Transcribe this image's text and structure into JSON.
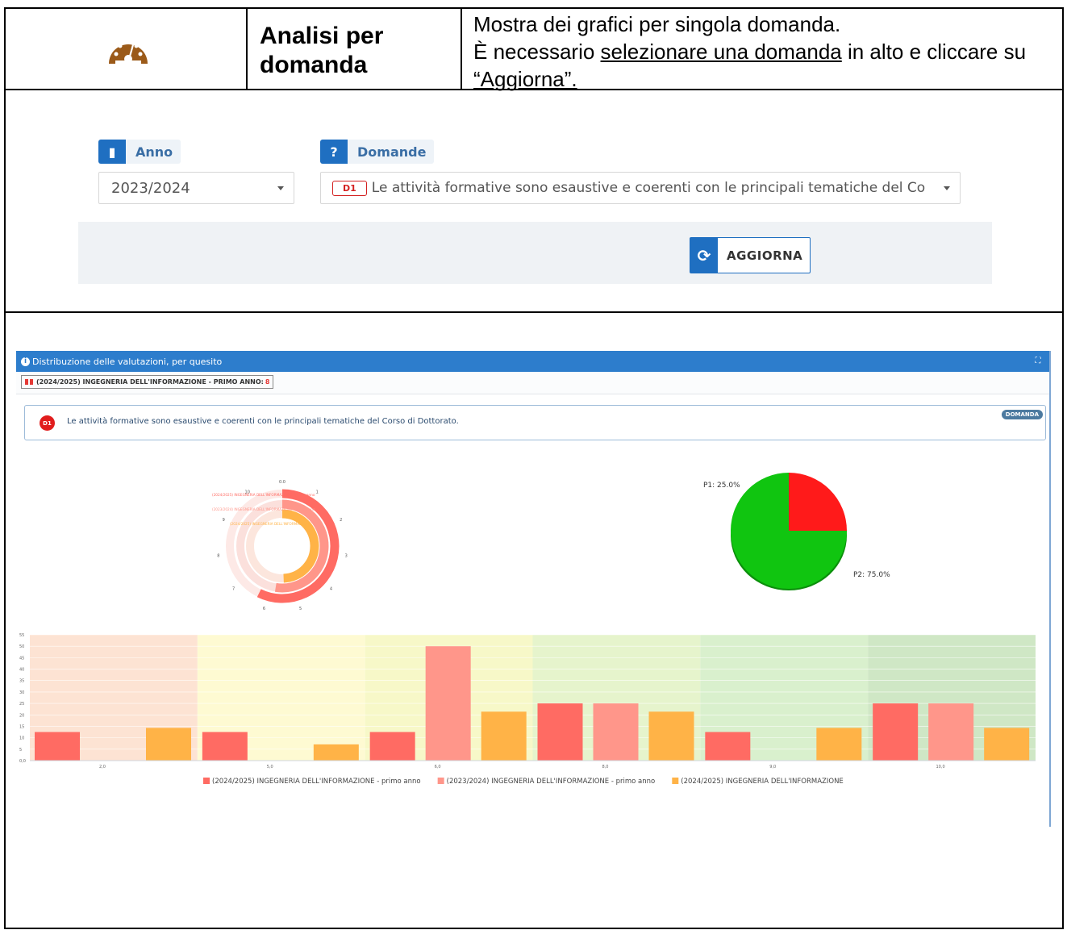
{
  "header": {
    "title": "Analisi per domanda",
    "desc_line1": "Mostra dei grafici per singola domanda.",
    "desc_pre": "È necessario ",
    "desc_link": "selezionare una domanda",
    "desc_mid": " in alto e cliccare su ",
    "desc_quote": "“Aggiorna”.",
    "icon": "dashboard-gauge-icon",
    "icon_color": "#9b5a19"
  },
  "filters": {
    "anno_label": "Anno",
    "anno_value": "2023/2024",
    "domande_label": "Domande",
    "domanda_badge": "D1",
    "domanda_value": "Le attività formative sono esaustive e coerenti con le principali tematiche del Co",
    "refresh_button": "AGGIORNA",
    "accent_color": "#1f6fc1"
  },
  "panel": {
    "title": "Distribuzione delle valutazioni, per quesito",
    "filter_tag": "(2024/2025) INGEGNERIA DELL'INFORMAZIONE - PRIMO ANNO:",
    "filter_count": "8",
    "question_badge": "D1",
    "question_text": "Le attività formative sono esaustive e coerenti con le principali tematiche del Corso di Dottorato.",
    "question_tag": "DOMANDA"
  },
  "chart_data": [
    {
      "type": "radial-bar",
      "series": [
        {
          "name": "(2024/2025) INGEGNERIA DELL'INFORMAZIONE - primo anno",
          "color": "#ff6b63"
        },
        {
          "name": "(2023/2024) INGEGNERIA DELL'INFORMAZIONE - primo anno",
          "color": "#ff968a"
        },
        {
          "name": "(2024/2025) INGEGNERIA DELL'INFORMAZIONE",
          "color": "#ffb347"
        }
      ],
      "ticks": [
        "0.0",
        "1",
        "2",
        "3",
        "4",
        "5",
        "6",
        "7",
        "8",
        "9",
        "10"
      ]
    },
    {
      "type": "pie",
      "slices": [
        {
          "label": "P1",
          "value": 25.0,
          "color": "#ff1a1a"
        },
        {
          "label": "P2",
          "value": 75.0,
          "color": "#10c510"
        }
      ],
      "labels": [
        "P1: 25.0%",
        "P2: 75.0%"
      ]
    },
    {
      "type": "bar",
      "categories": [
        "2,0",
        "5,0",
        "6,0",
        "8,0",
        "9,0",
        "10,0"
      ],
      "ylim": [
        0,
        55
      ],
      "yticks": [
        "0,0",
        "5",
        "10",
        "15",
        "20",
        "25",
        "30",
        "35",
        "40",
        "45",
        "50",
        "55"
      ],
      "band_colors": [
        "#fde3d3",
        "#fefad2",
        "#f7f8c8",
        "#e6f4cc",
        "#d9f0cd",
        "#cfe7c5"
      ],
      "series": [
        {
          "name": "(2024/2025) INGEGNERIA DELL'INFORMAZIONE - primo anno",
          "color": "#ff6b63",
          "values": [
            12.5,
            12.5,
            12.5,
            25,
            12.5,
            25
          ]
        },
        {
          "name": "(2023/2024) INGEGNERIA DELL'INFORMAZIONE - primo anno",
          "color": "#ff968a",
          "values": [
            0,
            0,
            50,
            25,
            0,
            25
          ]
        },
        {
          "name": "(2024/2025) INGEGNERIA DELL'INFORMAZIONE",
          "color": "#ffb347",
          "values": [
            14.3,
            7.1,
            21.4,
            21.4,
            14.3,
            14.3
          ]
        }
      ],
      "legend": "bottom"
    }
  ]
}
